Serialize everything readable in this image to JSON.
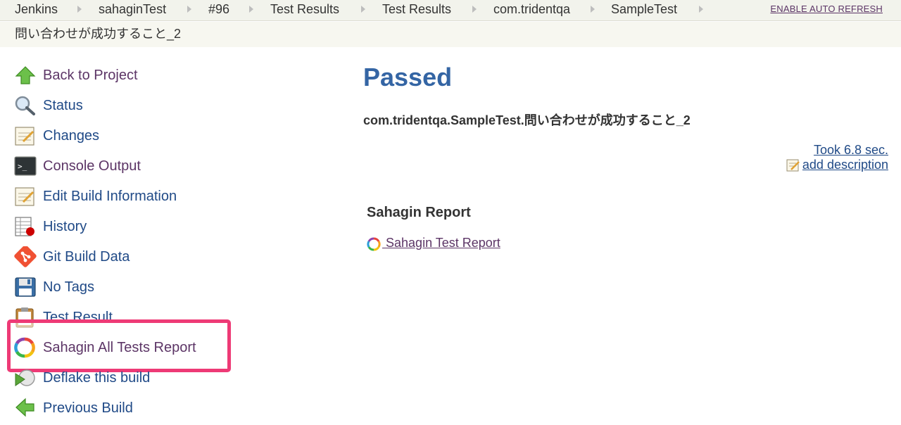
{
  "breadcrumb": {
    "items": [
      "Jenkins",
      "sahaginTest",
      "#96",
      "Test Results",
      "Test Results",
      "com.tridentqa",
      "SampleTest"
    ],
    "auto_refresh": "ENABLE AUTO REFRESH"
  },
  "page_title": "問い合わせが成功すること_2",
  "sidebar": {
    "items": [
      {
        "label": "Back to Project",
        "icon": "up-arrow-icon"
      },
      {
        "label": "Status",
        "icon": "magnifier-icon"
      },
      {
        "label": "Changes",
        "icon": "notepad-icon"
      },
      {
        "label": "Console Output",
        "icon": "terminal-icon"
      },
      {
        "label": "Edit Build Information",
        "icon": "notepad-icon"
      },
      {
        "label": "History",
        "icon": "history-icon"
      },
      {
        "label": "Git Build Data",
        "icon": "git-icon"
      },
      {
        "label": "No Tags",
        "icon": "floppy-disk-icon"
      },
      {
        "label": "Test Result",
        "icon": "clipboard-icon"
      },
      {
        "label": "Sahagin All Tests Report",
        "icon": "sahagin-ring-icon"
      },
      {
        "label": "Deflake this build",
        "icon": "deflake-icon"
      },
      {
        "label": "Previous Build",
        "icon": "left-arrow-icon"
      }
    ]
  },
  "main": {
    "status": "Passed",
    "test_name": "com.tridentqa.SampleTest.問い合わせが成功すること_2",
    "duration": "Took 6.8 sec.",
    "add_description": "add description",
    "sahagin_heading": "Sahagin Report",
    "sahagin_link": "Sahagin Test Report"
  },
  "colors": {
    "link": "#204a87",
    "visited_link": "#5c3566",
    "passed_heading": "#3465a4",
    "highlight_border": "#ee3a76",
    "breadcrumb_bg": "#f2f3ec"
  }
}
